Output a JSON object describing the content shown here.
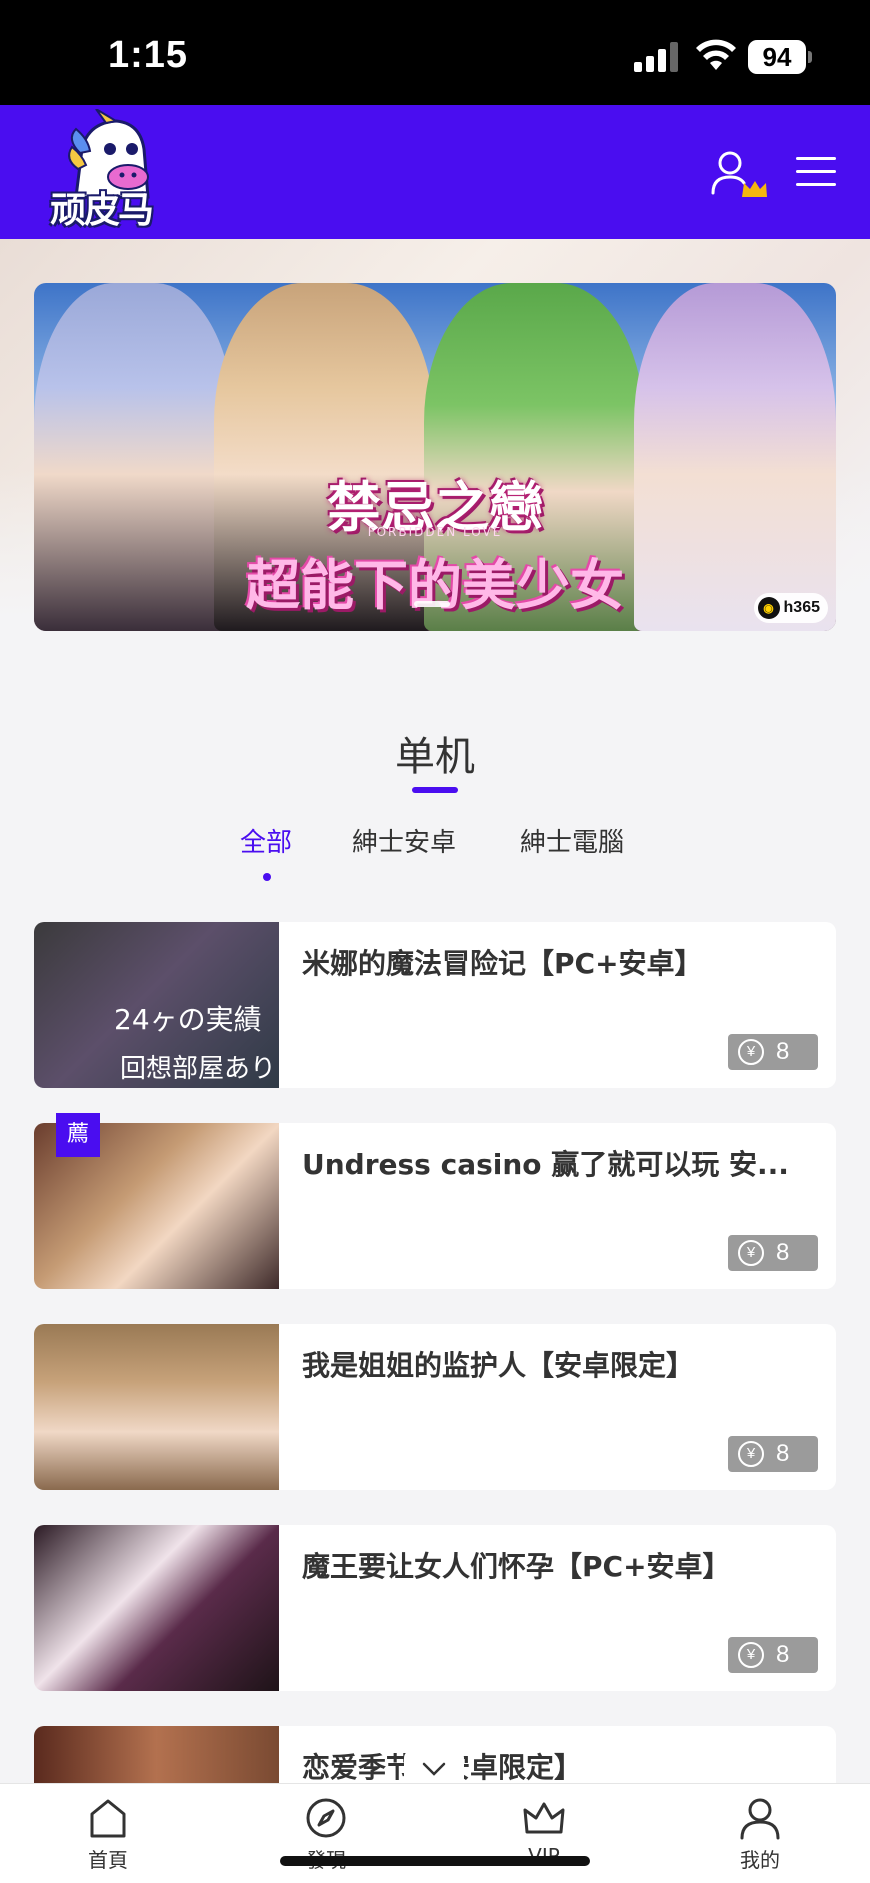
{
  "status_bar": {
    "time": "1:15",
    "battery": "94"
  },
  "header": {
    "logo_text": "顽皮马",
    "brand_color": "#4a0df0"
  },
  "banner": {
    "title": "禁忌之戀",
    "subtitle": "FORBIDDEN LOVE",
    "tagline": "超能下的美少女",
    "badge": "h365"
  },
  "section": {
    "title": "单机",
    "tabs": [
      {
        "label": "全部",
        "active": true
      },
      {
        "label": "紳士安卓",
        "active": false
      },
      {
        "label": "紳士電腦",
        "active": false
      }
    ]
  },
  "games": [
    {
      "title": "米娜的魔法冒险记【PC+安卓】",
      "price": "8",
      "thumb_text": "24ヶの実績",
      "thumb_text2": "回想部屋あり",
      "recommended": false
    },
    {
      "title": "Undress casino 赢了就可以玩 安...",
      "price": "8",
      "recommended": true,
      "badge": "薦"
    },
    {
      "title": "我是姐姐的监护人【安卓限定】",
      "price": "8",
      "recommended": false
    },
    {
      "title": "魔王要让女人们怀孕【PC+安卓】",
      "price": "8",
      "recommended": false
    },
    {
      "title": "恋爱季节【安卓限定】",
      "price": "",
      "recommended": false
    }
  ],
  "price_symbol": "¥",
  "bottom_nav": [
    {
      "label": "首頁",
      "icon": "home-icon"
    },
    {
      "label": "發現",
      "icon": "compass-icon"
    },
    {
      "label": "VIP",
      "icon": "crown-icon"
    },
    {
      "label": "我的",
      "icon": "user-icon"
    }
  ]
}
